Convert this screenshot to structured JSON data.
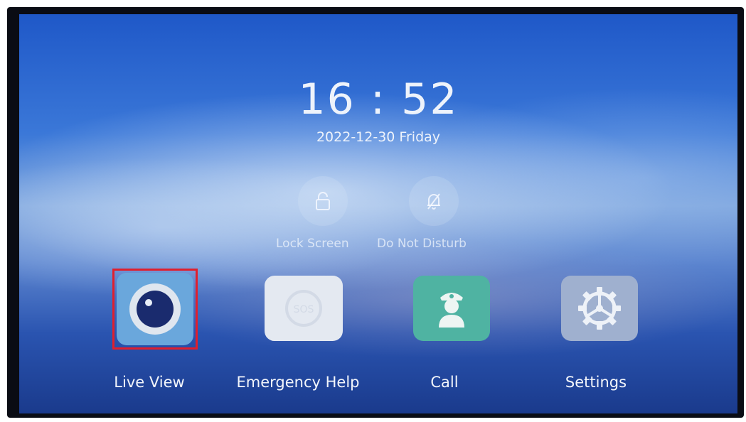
{
  "status": {
    "time": "16 : 52",
    "date": "2022-12-30 Friday"
  },
  "quick_actions": [
    {
      "label": "Lock Screen",
      "icon": "unlock-icon"
    },
    {
      "label": "Do Not Disturb",
      "icon": "bell-off-icon"
    }
  ],
  "apps": [
    {
      "label": "Live View",
      "icon": "camera-eye-icon",
      "selected": true
    },
    {
      "label": "Emergency Help",
      "icon": "sos-icon",
      "selected": false
    },
    {
      "label": "Call",
      "icon": "guard-icon",
      "selected": false
    },
    {
      "label": "Settings",
      "icon": "gear-icon",
      "selected": false
    }
  ],
  "colors": {
    "highlight": "#e01f2d",
    "live_view_tile": "#6aa7dc",
    "emergency_tile": "#e4e9f1",
    "call_tile": "#4fb3a2",
    "settings_tile": "#9fb0cf"
  }
}
